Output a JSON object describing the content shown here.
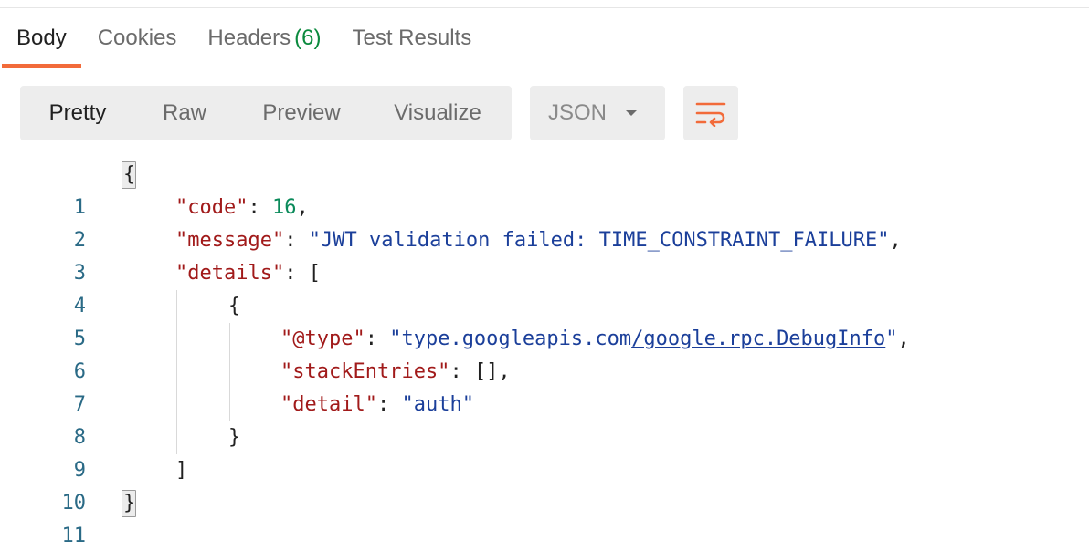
{
  "response_tabs": [
    {
      "label": "Body",
      "active": true
    },
    {
      "label": "Cookies",
      "active": false
    },
    {
      "label": "Headers",
      "count": "(6)",
      "active": false
    },
    {
      "label": "Test Results",
      "active": false
    }
  ],
  "view_modes": [
    {
      "label": "Pretty",
      "active": true
    },
    {
      "label": "Raw",
      "active": false
    },
    {
      "label": "Preview",
      "active": false
    },
    {
      "label": "Visualize",
      "active": false
    }
  ],
  "language_select": {
    "value": "JSON"
  },
  "wrap_button": {
    "icon": "wrap-lines-icon",
    "color": "#f26b3a"
  },
  "colors": {
    "accent": "#f26b3a",
    "key": "#a11a1a",
    "string": "#1b3f9a",
    "number": "#0a8a5a",
    "line_number": "#2a6a86",
    "header_count": "#0b8a3e"
  },
  "code_lines": [
    {
      "n": "1",
      "text": "{"
    },
    {
      "n": "2",
      "key": "\"code\"",
      "sep": ": ",
      "value": "16",
      "tail": ","
    },
    {
      "n": "3",
      "key": "\"message\"",
      "sep": ": ",
      "value": "\"JWT validation failed: TIME_CONSTRAINT_FAILURE\"",
      "tail": ","
    },
    {
      "n": "4",
      "key": "\"details\"",
      "sep": ": ",
      "tail": "["
    },
    {
      "n": "5",
      "text": "{"
    },
    {
      "n": "6",
      "key": "\"@type\"",
      "sep": ": ",
      "value_a": "\"type.googleapis.com",
      "value_b": "/google.rpc.DebugInfo",
      "value_c": "\"",
      "tail": ","
    },
    {
      "n": "7",
      "key": "\"stackEntries\"",
      "sep": ": ",
      "tail": "[],"
    },
    {
      "n": "8",
      "key": "\"detail\"",
      "sep": ": ",
      "value": "\"auth\""
    },
    {
      "n": "9",
      "text": "}"
    },
    {
      "n": "10",
      "text": "]"
    },
    {
      "n": "11",
      "text": "}"
    }
  ]
}
